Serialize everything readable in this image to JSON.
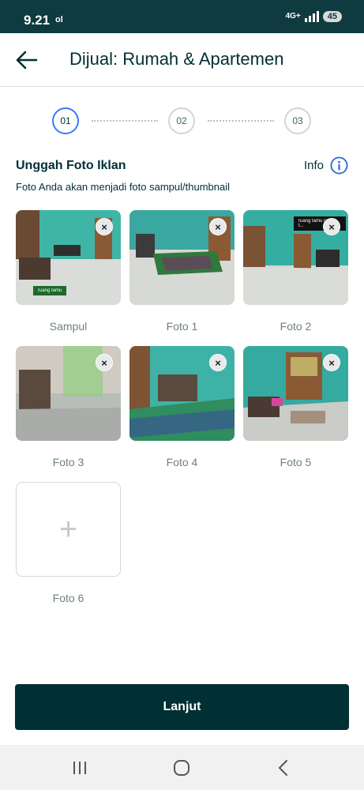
{
  "status_bar": {
    "time": "9.21",
    "carrier_icon": "ol",
    "network": "4G+",
    "battery": "45"
  },
  "header": {
    "title": "Dijual: Rumah & Apartemen",
    "back_icon": "arrow-left-icon"
  },
  "stepper": {
    "steps": [
      "01",
      "02",
      "03"
    ],
    "active_step": "01"
  },
  "upload": {
    "title": "Unggah Foto Iklan",
    "subtitle": "Foto Anda akan menjadi foto sampul/thumbnail",
    "info_label": "Info",
    "remove_label": "×",
    "photos": [
      {
        "caption": "Sampul",
        "tag": "ruang tamu"
      },
      {
        "caption": "Foto 1"
      },
      {
        "caption": "Foto 2",
        "tag": "ruang tamu ruang t..."
      },
      {
        "caption": "Foto 3"
      },
      {
        "caption": "Foto 4"
      },
      {
        "caption": "Foto 5"
      }
    ],
    "empty_slot": {
      "caption": "Foto 6",
      "icon": "plus-icon",
      "symbol": "+"
    }
  },
  "actions": {
    "next_label": "Lanjut"
  },
  "colors": {
    "primary": "#002f34",
    "accent": "#3a77ff",
    "status_bar": "#0f3a3f"
  }
}
